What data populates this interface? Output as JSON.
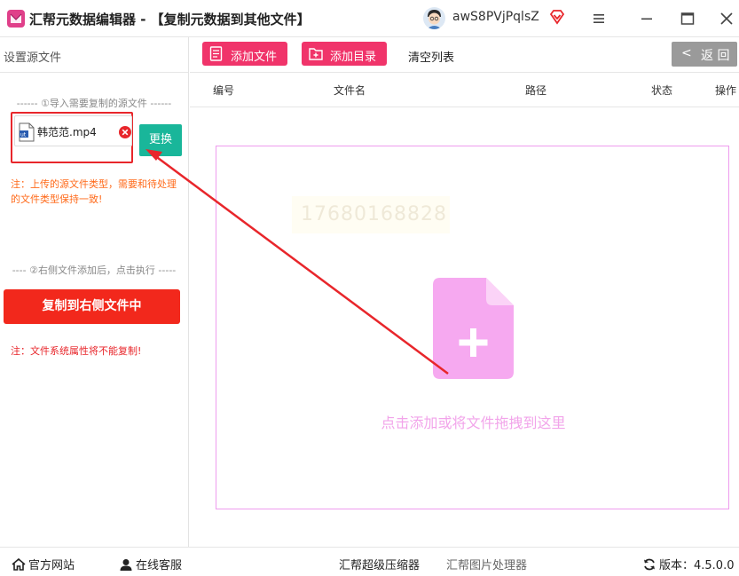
{
  "window": {
    "title": "汇帮元数据编辑器 - 【复制元数据到其他文件】",
    "username": "awS8PVjPqlsZ"
  },
  "sidebar": {
    "title": "设置源文件",
    "section1": "------ ①导入需要复制的源文件 ------",
    "file_name": "韩范范.mp4",
    "replace_label": "更换",
    "note1": "注：上传的源文件类型，需要和待处理的文件类型保持一致!",
    "section2": "---- ②右侧文件添加后，点击执行 -----",
    "copy_label": "复制到右侧文件中",
    "note2": "注：文件系统属性将不能复制!"
  },
  "toolbar": {
    "add_file": "添加文件",
    "add_dir": "添加目录",
    "clear_list": "清空列表",
    "back": "返 回"
  },
  "table": {
    "columns": [
      "编号",
      "文件名",
      "路径",
      "状态",
      "操作"
    ]
  },
  "drop_area": {
    "hint": "点击添加或将文件拖拽到这里",
    "watermark": "17680168828"
  },
  "bottom": {
    "site": "官方网站",
    "service": "在线客服",
    "compress": "汇帮超级压缩器",
    "image": "汇帮图片处理器",
    "version": "版本：4.5.0.0"
  },
  "colors": {
    "accent_pink": "#f0346a",
    "copy_red": "#f2281c",
    "replace_teal": "#19b69a",
    "drop_border": "#ee9cee",
    "doc_icon": "#f6a9f0",
    "annotation_red": "#e8262b"
  }
}
